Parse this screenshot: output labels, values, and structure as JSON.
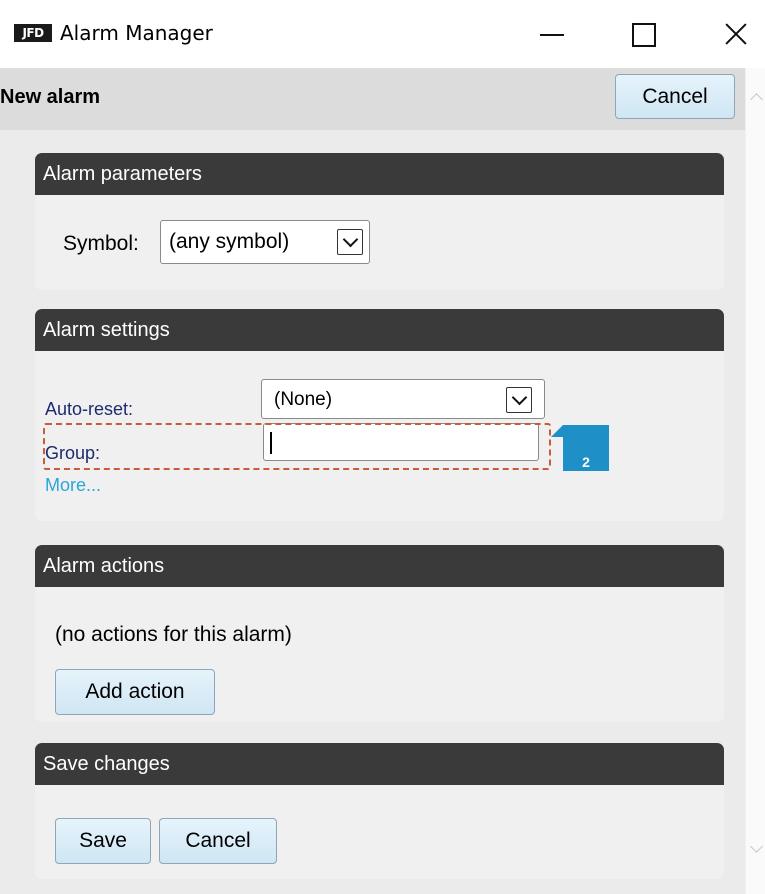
{
  "window": {
    "logo_text": "JFD",
    "title": "Alarm Manager"
  },
  "header": {
    "title": "New alarm",
    "cancel_label": "Cancel"
  },
  "alarm_parameters": {
    "heading": "Alarm parameters",
    "symbol_label": "Symbol:",
    "symbol_value": "(any symbol)"
  },
  "alarm_settings": {
    "heading": "Alarm settings",
    "auto_reset_label": "Auto-reset:",
    "auto_reset_value": "(None)",
    "group_label": "Group:",
    "group_value": "",
    "more_label": "More..."
  },
  "alarm_actions": {
    "heading": "Alarm actions",
    "empty_text": "(no actions for this alarm)",
    "add_action_label": "Add action"
  },
  "save_changes": {
    "heading": "Save changes",
    "save_label": "Save",
    "cancel_label": "Cancel"
  },
  "annotation": {
    "callout_number": "2",
    "callout_color": "#1e8fc7",
    "highlight_color": "#c75b3c"
  }
}
